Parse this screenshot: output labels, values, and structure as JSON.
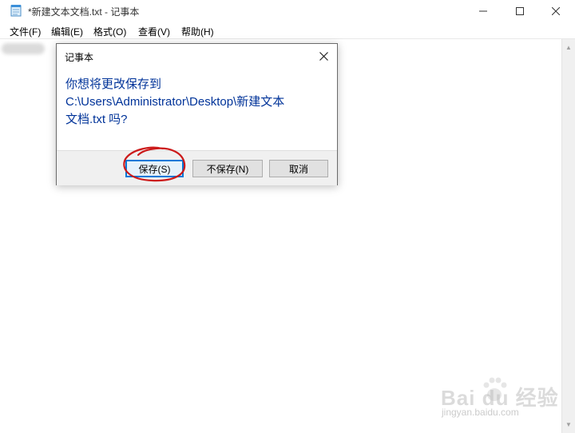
{
  "window": {
    "title": "*新建文本文档.txt - 记事本",
    "icon": "notepad-icon",
    "controls": [
      "minimize-icon",
      "maximize-icon",
      "close-icon"
    ]
  },
  "menu": {
    "items": [
      {
        "label": "文件(F)"
      },
      {
        "label": "编辑(E)"
      },
      {
        "label": "格式(O)"
      },
      {
        "label": "查看(V)"
      },
      {
        "label": "帮助(H)"
      }
    ]
  },
  "dialog": {
    "title": "记事本",
    "message_line1": "你想将更改保存到",
    "message_line2": "C:\\Users\\Administrator\\Desktop\\新建文本",
    "message_line3": "文档.txt 吗?",
    "buttons": {
      "save": "保存(S)",
      "dont_save": "不保存(N)",
      "cancel": "取消"
    },
    "message_color": "#003399",
    "primary_button_border": "#0078d7"
  },
  "annotation": {
    "circle_color": "#cc1a1a"
  },
  "watermark": {
    "brand": "Bai du 经验",
    "url": "jingyan.baidu.com"
  }
}
